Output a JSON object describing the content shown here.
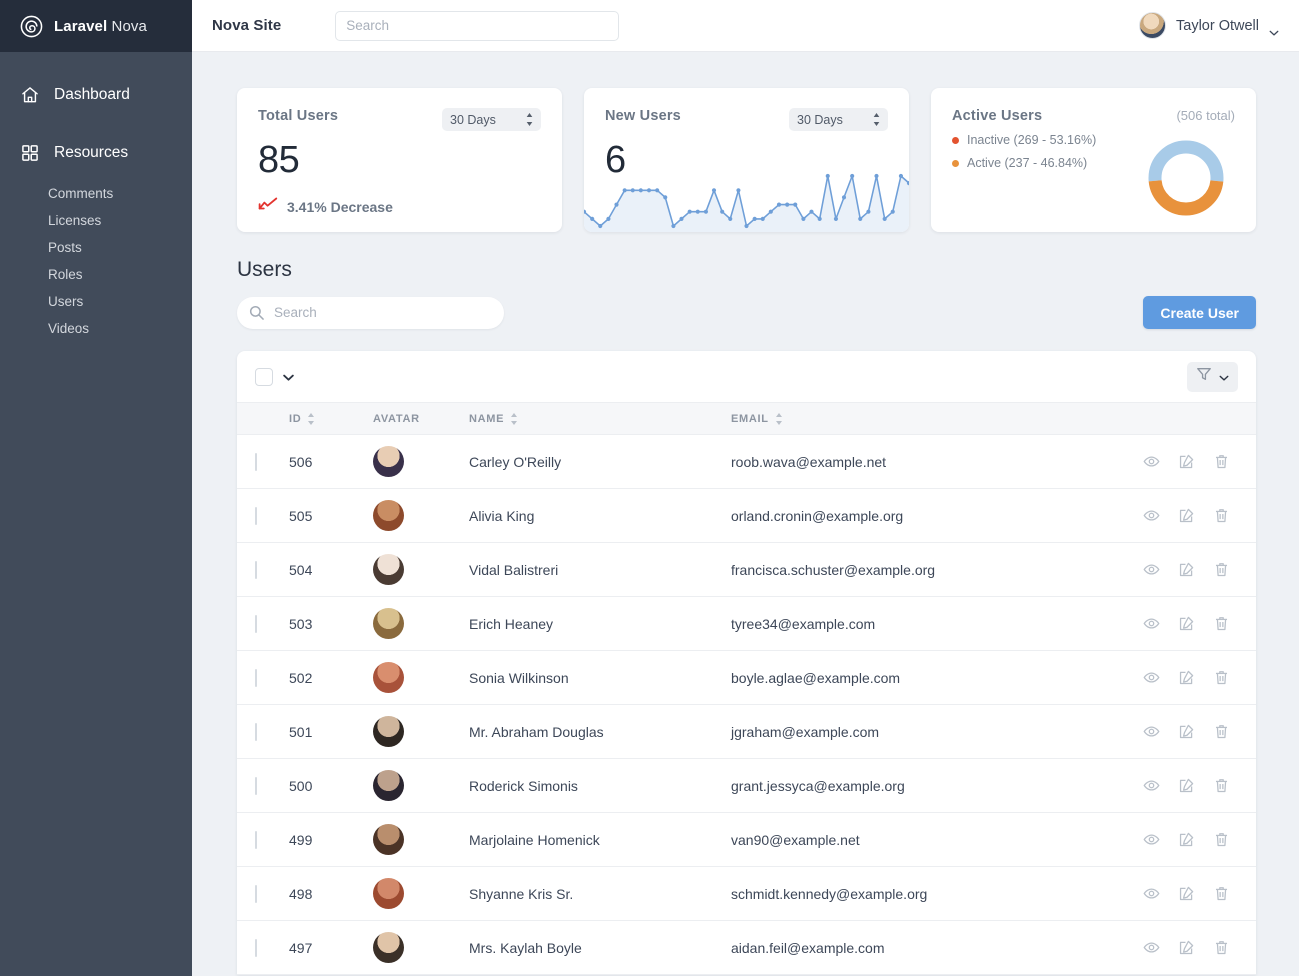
{
  "sidebar": {
    "brand": {
      "bold": "Laravel",
      "light": "Nova",
      "logo_icon": "spiral-logo-icon"
    },
    "items": [
      {
        "label": "Dashboard",
        "icon": "home-icon"
      },
      {
        "label": "Resources",
        "icon": "grid-icon"
      }
    ],
    "resources": [
      {
        "label": "Comments"
      },
      {
        "label": "Licenses"
      },
      {
        "label": "Posts"
      },
      {
        "label": "Roles"
      },
      {
        "label": "Users"
      },
      {
        "label": "Videos"
      }
    ]
  },
  "topbar": {
    "site_title": "Nova Site",
    "search_placeholder": "Search",
    "search_value": "",
    "user_name": "Taylor Otwell",
    "caret_icon": "chevron-down-icon",
    "avatar_icon": "avatar"
  },
  "metrics": {
    "total_users": {
      "title": "Total Users",
      "range": "30 Days",
      "value": "85",
      "trend_text": "3.41% Decrease",
      "trend_icon": "trend-down-icon",
      "trend_color": "#e3342f"
    },
    "new_users": {
      "title": "New Users",
      "range": "30 Days",
      "value": "6",
      "line_color": "#6f9fd8"
    },
    "active_users": {
      "title": "Active Users",
      "total_label": "(506 total)",
      "legend": [
        {
          "label": "Inactive (269 - 53.16%)",
          "dot_color": "#e3532f",
          "arc_color": "#a8cbe8"
        },
        {
          "label": "Active (237 - 46.84%)",
          "dot_color": "#e8923c",
          "arc_color": "#e8923c"
        }
      ]
    }
  },
  "chart_data": [
    {
      "type": "line",
      "title": "New Users",
      "xlabel": "",
      "ylabel": "",
      "x": [
        1,
        2,
        3,
        4,
        5,
        6,
        7,
        8,
        9,
        10,
        11,
        12,
        13,
        14,
        15,
        16,
        17,
        18,
        19,
        20,
        21,
        22,
        23,
        24,
        25,
        26,
        27,
        28,
        29,
        30,
        31,
        32,
        33,
        34,
        35,
        36,
        37,
        38,
        39,
        40,
        41
      ],
      "values": [
        2,
        1,
        0,
        1,
        3,
        5,
        5,
        5,
        5,
        5,
        4,
        0,
        1,
        2,
        2,
        2,
        5,
        2,
        1,
        5,
        0,
        1,
        1,
        2,
        3,
        3,
        3,
        1,
        2,
        1,
        7,
        1,
        4,
        7,
        1,
        2,
        7,
        1,
        2,
        7,
        6
      ],
      "ylim": [
        0,
        7
      ],
      "grid": false,
      "legend": "none"
    },
    {
      "type": "pie",
      "title": "Active Users",
      "labels": [
        "Inactive",
        "Active"
      ],
      "values": [
        269,
        237
      ],
      "percents": [
        53.16,
        46.84
      ],
      "colors": [
        "#a8cbe8",
        "#e8923c"
      ],
      "total": 506,
      "legend": "left"
    }
  ],
  "users_section": {
    "heading": "Users",
    "search_placeholder": "Search",
    "search_value": "",
    "create_label": "Create User",
    "filter_icon": "filter-icon",
    "select_all_icon": "checkbox",
    "dropdown_icon": "chevron-down-icon"
  },
  "table": {
    "columns": [
      {
        "label": "ID",
        "sortable": true
      },
      {
        "label": "AVATAR",
        "sortable": false
      },
      {
        "label": "NAME",
        "sortable": true
      },
      {
        "label": "EMAIL",
        "sortable": true
      }
    ],
    "row_actions": [
      {
        "icon": "eye-icon"
      },
      {
        "icon": "pencil-icon"
      },
      {
        "icon": "trash-icon"
      }
    ],
    "rows": [
      {
        "id": "506",
        "name": "Carley O'Reilly",
        "email": "roob.wava@example.net",
        "avatar_colors": [
          "#e8cdb4",
          "#39304a"
        ]
      },
      {
        "id": "505",
        "name": "Alivia King",
        "email": "orland.cronin@example.org",
        "avatar_colors": [
          "#c98d63",
          "#8d4a2c"
        ]
      },
      {
        "id": "504",
        "name": "Vidal Balistreri",
        "email": "francisca.schuster@example.org",
        "avatar_colors": [
          "#efe1d6",
          "#4a3b33"
        ]
      },
      {
        "id": "503",
        "name": "Erich Heaney",
        "email": "tyree34@example.com",
        "avatar_colors": [
          "#d8c08e",
          "#8a6a3d"
        ]
      },
      {
        "id": "502",
        "name": "Sonia Wilkinson",
        "email": "boyle.aglae@example.com",
        "avatar_colors": [
          "#d98e6e",
          "#a8523a"
        ]
      },
      {
        "id": "501",
        "name": "Mr. Abraham Douglas",
        "email": "jgraham@example.com",
        "avatar_colors": [
          "#cfb59c",
          "#2e2722"
        ]
      },
      {
        "id": "500",
        "name": "Roderick Simonis",
        "email": "grant.jessyca@example.org",
        "avatar_colors": [
          "#bda18c",
          "#2a2530"
        ]
      },
      {
        "id": "499",
        "name": "Marjolaine Homenick",
        "email": "van90@example.net",
        "avatar_colors": [
          "#b98e6d",
          "#4b3326"
        ]
      },
      {
        "id": "498",
        "name": "Shyanne Kris Sr.",
        "email": "schmidt.kennedy@example.org",
        "avatar_colors": [
          "#d2886a",
          "#9c4a30"
        ]
      },
      {
        "id": "497",
        "name": "Mrs. Kaylah Boyle",
        "email": "aidan.feil@example.com",
        "avatar_colors": [
          "#e0c4a8",
          "#3b3028"
        ]
      }
    ]
  }
}
